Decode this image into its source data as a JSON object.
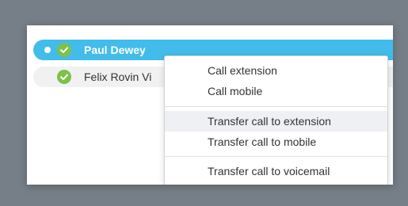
{
  "contacts": [
    {
      "name": "Paul Dewey",
      "status": "available",
      "selected": true
    },
    {
      "name": "Felix Rovin Vi",
      "status": "available",
      "selected": false
    }
  ],
  "context_menu": {
    "items": [
      {
        "label": "Call extension"
      },
      {
        "label": "Call mobile"
      },
      {
        "label": "Transfer call to extension"
      },
      {
        "label": "Transfer call to mobile"
      },
      {
        "label": "Transfer call to voicemail"
      }
    ]
  },
  "colors": {
    "selected_row": "#42bcea",
    "status_available": "#7cc24a",
    "background": "#767e88"
  }
}
